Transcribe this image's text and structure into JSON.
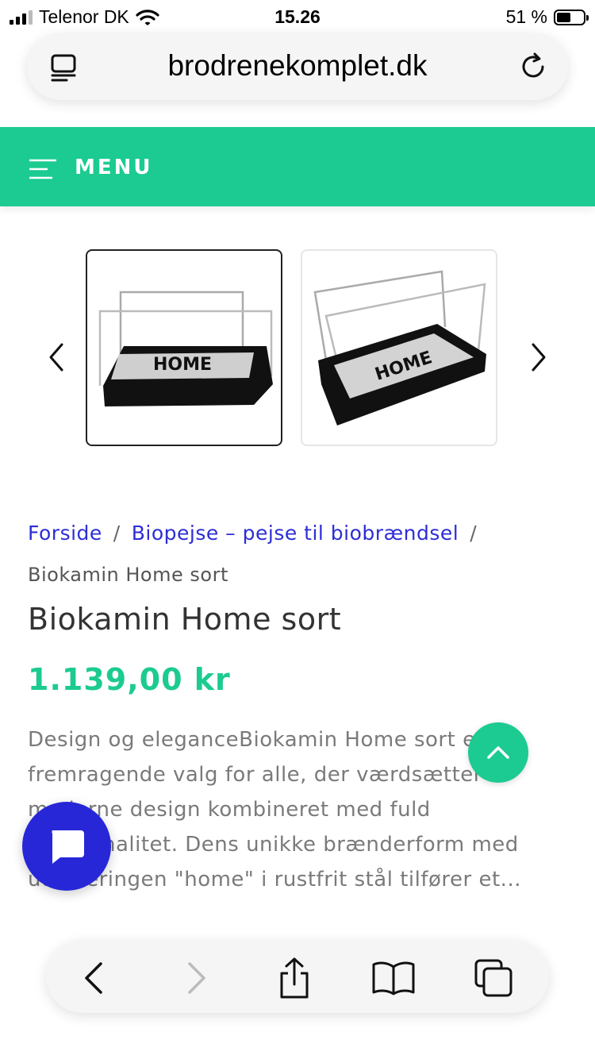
{
  "status_bar": {
    "carrier": "Telenor DK",
    "time": "15.26",
    "battery": "51 %",
    "battery_level": 0.51
  },
  "browser": {
    "url": "brodrenekomplet.dk"
  },
  "nav": {
    "menu_label": "MENU"
  },
  "gallery": {
    "thumbnails": [
      {
        "alt_icon": "product-front-view",
        "selected": true
      },
      {
        "alt_icon": "product-angled-view",
        "selected": false
      }
    ],
    "logo_text": "HOME"
  },
  "breadcrumb": {
    "items": [
      "Forside",
      "Biopejse – pejse til biobrændsel"
    ],
    "separator": "/",
    "current": "Biokamin Home sort"
  },
  "product": {
    "title": "Biokamin Home sort",
    "price": "1.139,00 kr",
    "description": "Design og eleganceBiokamin Home sort er et fremragende valg for alle, der værdsætter moderne design kombineret med fuld funktionalitet. Dens unikke brænderform med udskæringen \"home\" i rustfrit stål tilfører et..."
  },
  "colors": {
    "accent": "#1ccb91",
    "link": "#2d2dd6",
    "chat": "#2727d8"
  }
}
